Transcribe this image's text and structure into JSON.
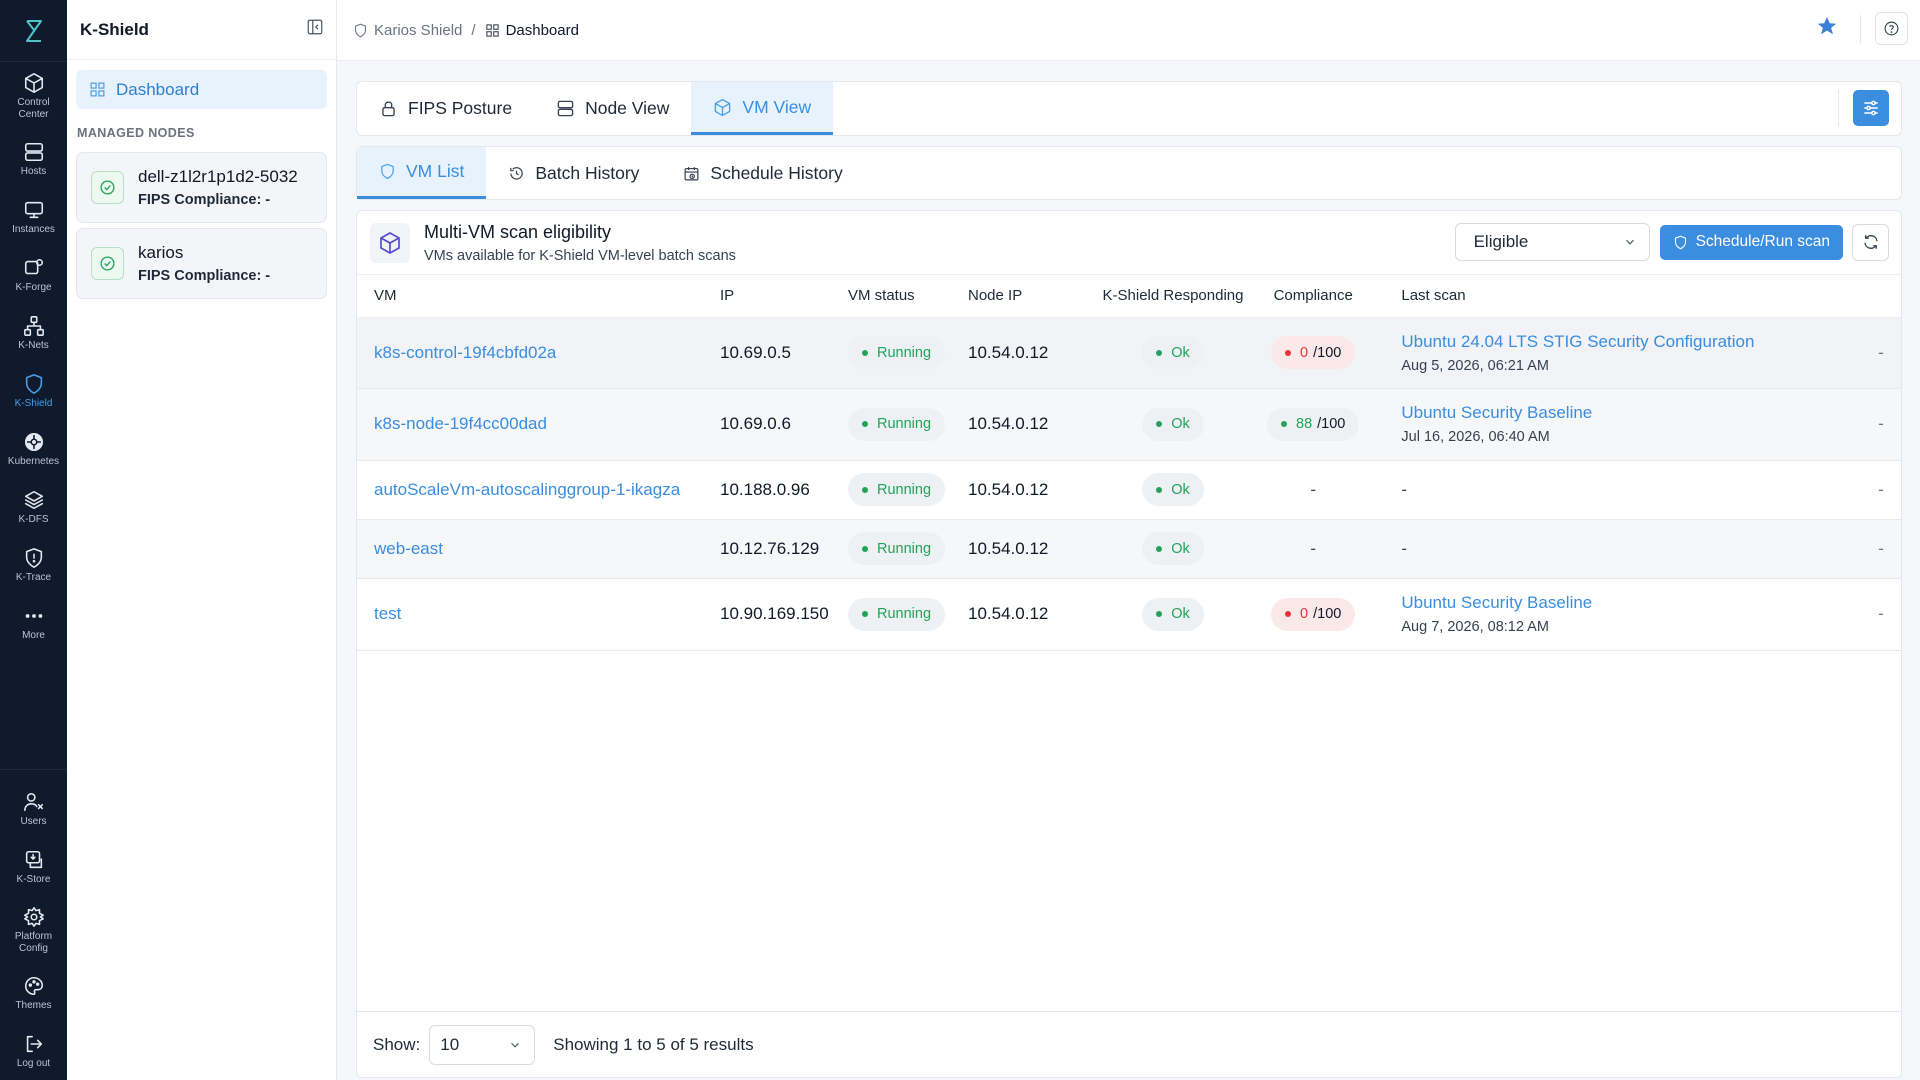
{
  "rail": {
    "items": [
      {
        "label": "Control\nCenter",
        "icon": "cube-icon"
      },
      {
        "label": "Hosts",
        "icon": "server-icon"
      },
      {
        "label": "Instances",
        "icon": "monitor-icon"
      },
      {
        "label": "K-Forge",
        "icon": "forge-icon"
      },
      {
        "label": "K-Nets",
        "icon": "network-icon"
      },
      {
        "label": "K-Shield",
        "icon": "shield-icon"
      },
      {
        "label": "Kubernetes",
        "icon": "kubernetes-icon"
      },
      {
        "label": "K-DFS",
        "icon": "layers-icon"
      },
      {
        "label": "K-Trace",
        "icon": "trace-icon"
      },
      {
        "label": "More",
        "icon": "more-icon"
      }
    ],
    "bottom": [
      {
        "label": "Users",
        "icon": "users-icon"
      },
      {
        "label": "K-Store",
        "icon": "store-icon"
      },
      {
        "label": "Platform\nConfig",
        "icon": "gear-icon"
      },
      {
        "label": "Themes",
        "icon": "palette-icon"
      },
      {
        "label": "Log out",
        "icon": "logout-icon"
      }
    ]
  },
  "side": {
    "title": "K-Shield",
    "dashboard_label": "Dashboard",
    "section_label": "MANAGED NODES",
    "nodes": [
      {
        "name": "dell-z1l2r1p1d2-5032",
        "compliance": "FIPS Compliance: -"
      },
      {
        "name": "karios",
        "compliance": "FIPS Compliance: -"
      }
    ]
  },
  "breadcrumb": {
    "root": "Karios Shield",
    "separator": "/",
    "current": "Dashboard"
  },
  "main_tabs": [
    "FIPS Posture",
    "Node View",
    "VM View"
  ],
  "sub_tabs": [
    "VM List",
    "Batch History",
    "Schedule History"
  ],
  "card": {
    "title": "Multi-VM scan eligibility",
    "subtitle": "VMs available for K-Shield VM-level batch scans",
    "filter_value": "Eligible",
    "run_label": "Schedule/Run scan"
  },
  "table": {
    "headers": [
      "VM",
      "IP",
      "VM status",
      "Node IP",
      "K-Shield Responding",
      "Compliance",
      "Last scan"
    ],
    "rows": [
      {
        "vm": "k8s-control-19f4cbfd02a",
        "ip": "10.69.0.5",
        "status": "Running",
        "node_ip": "10.54.0.12",
        "responding": "Ok",
        "compliance_score": "0",
        "compliance_max": "/100",
        "compliance_state": "red",
        "scan_name": "Ubuntu 24.04 LTS STIG Security Configuration",
        "scan_date": "Aug 5, 2026, 06:21 AM",
        "end": "-"
      },
      {
        "vm": "k8s-node-19f4cc00dad",
        "ip": "10.69.0.6",
        "status": "Running",
        "node_ip": "10.54.0.12",
        "responding": "Ok",
        "compliance_score": "88",
        "compliance_max": "/100",
        "compliance_state": "green",
        "scan_name": "Ubuntu Security Baseline",
        "scan_date": "Jul 16, 2026, 06:40 AM",
        "end": "-"
      },
      {
        "vm": "autoScaleVm-autoscalinggroup-1-ikagza",
        "ip": "10.188.0.96",
        "status": "Running",
        "node_ip": "10.54.0.12",
        "responding": "Ok",
        "compliance_dash": "-",
        "scan_dash": "-",
        "end": "-"
      },
      {
        "vm": "web-east",
        "ip": "10.12.76.129",
        "status": "Running",
        "node_ip": "10.54.0.12",
        "responding": "Ok",
        "compliance_dash": "-",
        "scan_dash": "-",
        "end": "-"
      },
      {
        "vm": "test",
        "ip": "10.90.169.150",
        "status": "Running",
        "node_ip": "10.54.0.12",
        "responding": "Ok",
        "compliance_score": "0",
        "compliance_max": "/100",
        "compliance_state": "red",
        "scan_name": "Ubuntu Security Baseline",
        "scan_date": "Aug 7, 2026, 08:12 AM",
        "end": "-"
      }
    ]
  },
  "footer": {
    "show_label": "Show:",
    "page_size": "10",
    "summary": "Showing 1 to 5 of 5 results"
  },
  "colors": {
    "accent": "#3b8de0",
    "rail_bg": "#0f1b2d",
    "ok_green": "#22a35a",
    "fail_red": "#e5353b"
  }
}
